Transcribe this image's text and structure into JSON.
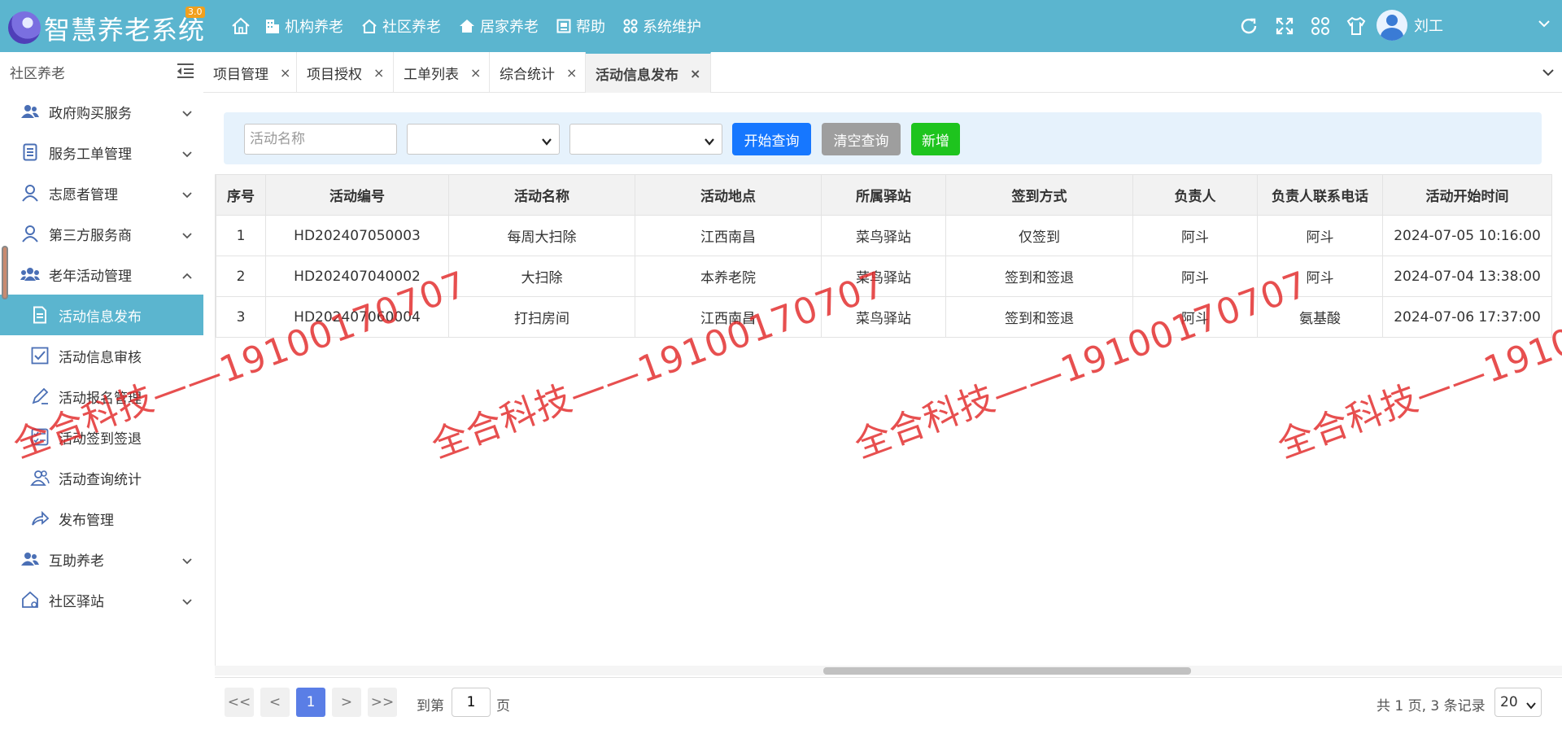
{
  "app": {
    "title": "智慧养老系统",
    "version_badge": "3.0",
    "nav": [
      {
        "label": "机构养老",
        "icon": "building-icon"
      },
      {
        "label": "社区养老",
        "icon": "house-icon"
      },
      {
        "label": "居家养老",
        "icon": "home-filled-icon"
      },
      {
        "label": "帮助",
        "icon": "help-icon"
      },
      {
        "label": "系统维护",
        "icon": "grid-icon"
      }
    ],
    "user": {
      "name": "刘工"
    }
  },
  "sidebar": {
    "title": "社区养老",
    "menus": [
      {
        "label": "政府购买服务"
      },
      {
        "label": "服务工单管理"
      },
      {
        "label": "志愿者管理"
      },
      {
        "label": "第三方服务商"
      },
      {
        "label": "老年活动管理"
      },
      {
        "label": "互助养老"
      },
      {
        "label": "社区驿站"
      }
    ],
    "submenu": [
      {
        "label": "活动信息发布"
      },
      {
        "label": "活动信息审核"
      },
      {
        "label": "活动报名管理"
      },
      {
        "label": "活动签到签退"
      },
      {
        "label": "活动查询统计"
      },
      {
        "label": "发布管理"
      }
    ]
  },
  "tabs": [
    {
      "label": "项目管理",
      "close": "×"
    },
    {
      "label": "项目授权",
      "close": "×"
    },
    {
      "label": "工单列表",
      "close": "×"
    },
    {
      "label": "综合统计",
      "close": "×"
    },
    {
      "label": "活动信息发布",
      "close": "×",
      "active": true
    }
  ],
  "filter": {
    "name_placeholder": "活动名称",
    "search_button": "开始查询",
    "clear_button": "清空查询",
    "add_button": "新增",
    "colors": {
      "search": "#1677ff",
      "clear": "#9e9e9e",
      "add": "#1ec41e"
    }
  },
  "table": {
    "columns": [
      "序号",
      "活动编号",
      "活动名称",
      "活动地点",
      "所属驿站",
      "签到方式",
      "负责人",
      "负责人联系电话",
      "活动开始时间"
    ],
    "rows": [
      [
        "1",
        "HD202407050003",
        "每周大扫除",
        "江西南昌",
        "菜鸟驿站",
        "仅签到",
        "阿斗",
        "阿斗",
        "2024-07-05 10:16:00"
      ],
      [
        "2",
        "HD202407040002",
        "大扫除",
        "本养老院",
        "菜鸟驿站",
        "签到和签退",
        "阿斗",
        "阿斗",
        "2024-07-04 13:38:00"
      ],
      [
        "3",
        "HD202407060004",
        "打扫房间",
        "江西南昌",
        "菜鸟驿站",
        "签到和签退",
        "阿斗",
        "氨基酸",
        "2024-07-06 17:37:00"
      ]
    ]
  },
  "pager": {
    "first": "<<",
    "prev": "<",
    "current": "1",
    "next": ">",
    "last": ">>",
    "goto_prefix": "到第",
    "goto_value": "1",
    "goto_suffix": "页",
    "summary": "共 1 页, 3 条记录",
    "page_size": "20"
  },
  "watermark": {
    "text": "全合科技——19100170707"
  }
}
